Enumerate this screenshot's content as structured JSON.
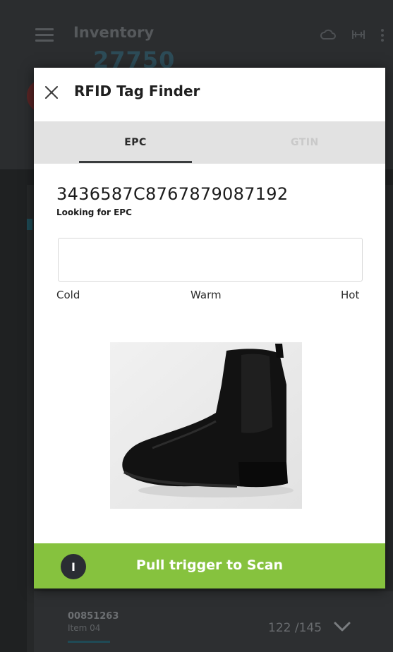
{
  "background": {
    "title": "Inventory",
    "count": "27750",
    "item": {
      "id": "00851263",
      "name": "Item 04",
      "progress": "122 /145"
    }
  },
  "modal": {
    "title": "RFID Tag Finder",
    "tabs": [
      {
        "label": "EPC",
        "active": true
      },
      {
        "label": "GTIN",
        "active": false
      }
    ],
    "epc_value": "3436587C8767879087192",
    "epc_caption": "Looking for EPC",
    "proximity": {
      "level": 0,
      "labels": {
        "cold": "Cold",
        "warm": "Warm",
        "hot": "Hot"
      }
    },
    "product_image": "black-chelsea-boot",
    "scan_button": {
      "icon_text": "I",
      "label": "Pull trigger to Scan"
    }
  },
  "colors": {
    "accent_green": "#86c23e",
    "tab_bar": "#e2e2e2",
    "dark_icon": "#2a2d33"
  }
}
